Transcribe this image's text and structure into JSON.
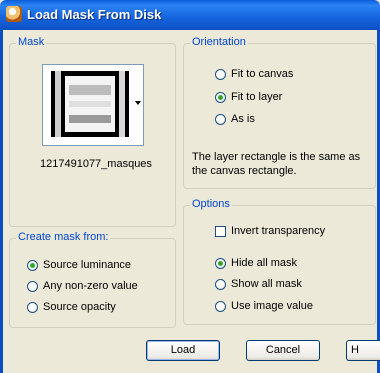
{
  "window": {
    "title": "Load Mask From Disk"
  },
  "mask": {
    "legend": "Mask",
    "file_name": "1217491077_masques"
  },
  "orientation": {
    "legend": "Orientation",
    "options": [
      "Fit to canvas",
      "Fit to layer",
      "As is"
    ],
    "selected": "Fit to layer",
    "description": "The layer rectangle is the same as the canvas rectangle."
  },
  "create_mask": {
    "legend": "Create mask from:",
    "options": [
      "Source luminance",
      "Any non-zero value",
      "Source opacity"
    ],
    "selected": "Source luminance"
  },
  "options": {
    "legend": "Options",
    "invert_label": "Invert transparency",
    "invert_checked": false,
    "mask_options": [
      "Hide all mask",
      "Show all mask",
      "Use image value"
    ],
    "selected": "Hide all mask"
  },
  "buttons": {
    "load": "Load",
    "cancel": "Cancel",
    "help": "H"
  }
}
